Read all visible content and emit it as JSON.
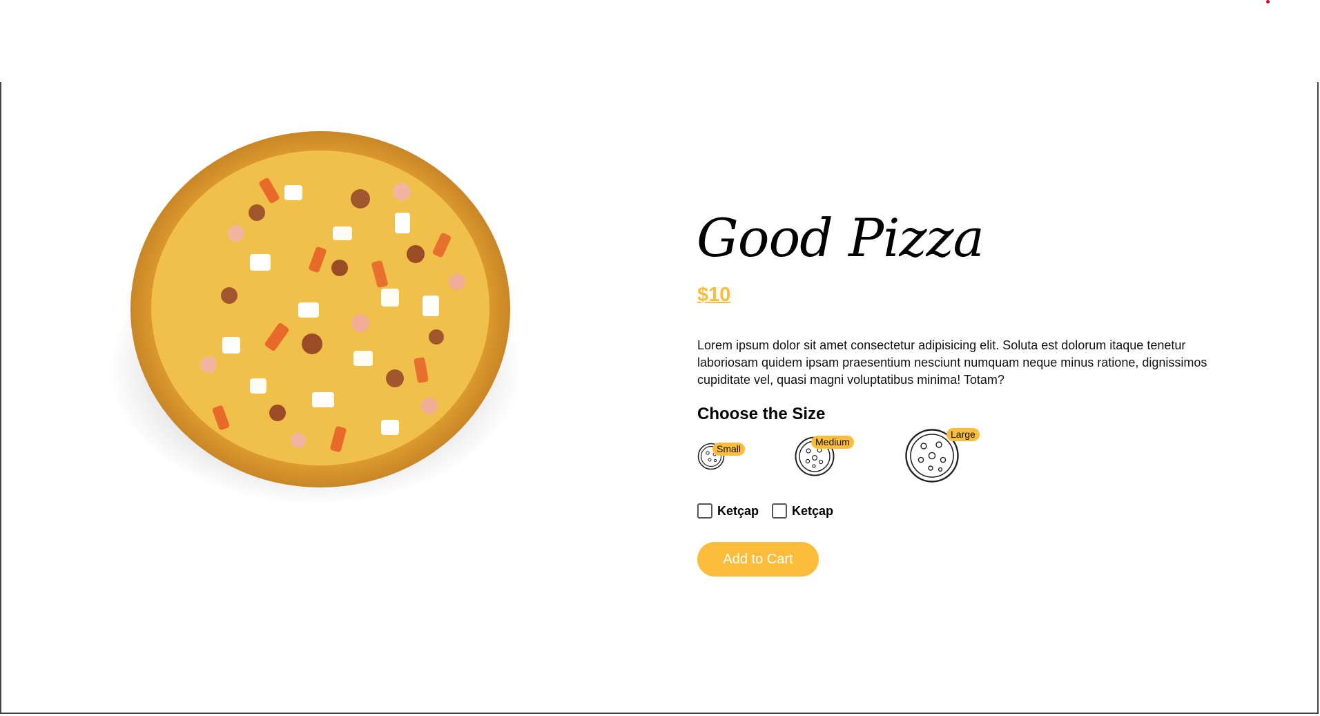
{
  "product": {
    "name": "Good Pizza",
    "price": "$10",
    "description": "Lorem ipsum dolor sit amet consectetur adipisicing elit. Soluta est dolorum itaque tenetur laboriosam quidem ipsam praesentium nesciunt numquam neque minus ratione, dignissimos cupiditate vel, quasi magni voluptatibus minima! Totam?"
  },
  "sizes": {
    "heading": "Choose the Size",
    "options": [
      {
        "label": "Small"
      },
      {
        "label": "Medium"
      },
      {
        "label": "Large"
      }
    ]
  },
  "toppings": [
    {
      "label": "Ketçap",
      "checked": false
    },
    {
      "label": "Ketçap",
      "checked": false
    }
  ],
  "actions": {
    "add_to_cart": "Add to Cart"
  },
  "colors": {
    "accent": "#fbbd3b",
    "text": "#000000",
    "border": "#444444"
  },
  "icons": {
    "product_image": "pizza-photo",
    "size_icon": "pizza-outline-icon"
  }
}
